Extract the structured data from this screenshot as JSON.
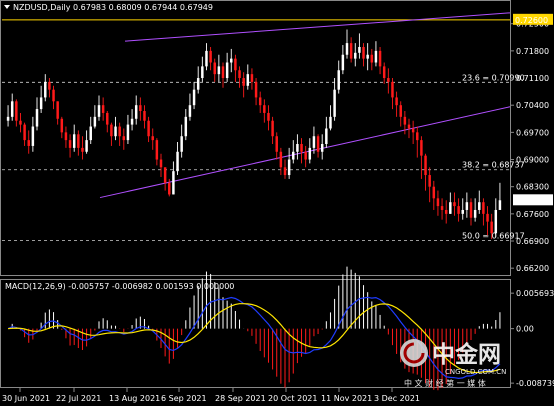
{
  "chart_data": [
    {
      "type": "candlestick",
      "title": "NZDUSD,Daily",
      "ohlc_header": "0.67983 0.68009 0.67944 0.67949",
      "price_ticks": [
        "0.72500",
        "0.71800",
        "0.71100",
        "0.70400",
        "0.69700",
        "0.69000",
        "0.68300",
        "0.67600",
        "0.66900",
        "0.66200"
      ],
      "price_range": [
        0.6605,
        0.7275
      ],
      "current_price": "0.67949",
      "highlight_level": {
        "price": 0.726,
        "label": "0.72600",
        "color": "#ffd700"
      },
      "fib_levels": [
        {
          "label": "23.6 = 0.70990",
          "price": 0.7099
        },
        {
          "label": "38.2 = 0.68737",
          "price": 0.68737
        },
        {
          "label": "50.0 = 0.66917",
          "price": 0.66917
        }
      ],
      "x_labels": [
        "30 Jun 2021",
        "22 Jul 2021",
        "13 Aug 2021",
        "6 Sep 2021",
        "28 Sep 2021",
        "20 Oct 2021",
        "11 Nov 2021",
        "3 Dec 2021"
      ],
      "channel_color": "#b050ff",
      "bull_color": "#ffffff",
      "bear_color": "#ff1a1a",
      "closes": [
        0.701,
        0.705,
        0.7,
        0.699,
        0.695,
        0.6935,
        0.6985,
        0.703,
        0.706,
        0.71,
        0.708,
        0.705,
        0.7005,
        0.697,
        0.695,
        0.693,
        0.6965,
        0.693,
        0.692,
        0.695,
        0.6985,
        0.701,
        0.704,
        0.702,
        0.699,
        0.696,
        0.6985,
        0.696,
        0.695,
        0.699,
        0.7005,
        0.704,
        0.7025,
        0.7,
        0.696,
        0.695,
        0.69,
        0.688,
        0.684,
        0.681,
        0.687,
        0.692,
        0.696,
        0.701,
        0.704,
        0.708,
        0.711,
        0.714,
        0.718,
        0.715,
        0.712,
        0.714,
        0.711,
        0.715,
        0.716,
        0.713,
        0.711,
        0.709,
        0.712,
        0.71,
        0.706,
        0.704,
        0.702,
        0.7,
        0.696,
        0.692,
        0.688,
        0.686,
        0.69,
        0.692,
        0.694,
        0.692,
        0.69,
        0.693,
        0.696,
        0.692,
        0.694,
        0.698,
        0.701,
        0.708,
        0.713,
        0.717,
        0.72,
        0.716,
        0.7175,
        0.719,
        0.716,
        0.717,
        0.715,
        0.718,
        0.714,
        0.711,
        0.71,
        0.706,
        0.704,
        0.701,
        0.699,
        0.698,
        0.697,
        0.695,
        0.691,
        0.686,
        0.683,
        0.68,
        0.678,
        0.677,
        0.676,
        0.679,
        0.678,
        0.676,
        0.677,
        0.679,
        0.675,
        0.677,
        0.679,
        0.676,
        0.674,
        0.671,
        0.677,
        0.6795
      ],
      "highs": [
        0.704,
        0.707,
        0.7055,
        0.702,
        0.6995,
        0.6975,
        0.701,
        0.706,
        0.709,
        0.712,
        0.711,
        0.709,
        0.705,
        0.701,
        0.6985,
        0.6965,
        0.699,
        0.6975,
        0.696,
        0.6975,
        0.701,
        0.704,
        0.7065,
        0.706,
        0.7025,
        0.6995,
        0.701,
        0.6995,
        0.698,
        0.7015,
        0.703,
        0.7065,
        0.706,
        0.704,
        0.701,
        0.698,
        0.6955,
        0.6915,
        0.688,
        0.685,
        0.6895,
        0.6945,
        0.699,
        0.703,
        0.707,
        0.71,
        0.714,
        0.7165,
        0.72,
        0.719,
        0.716,
        0.717,
        0.715,
        0.7175,
        0.7185,
        0.717,
        0.714,
        0.7125,
        0.7145,
        0.7135,
        0.711,
        0.7075,
        0.7055,
        0.704,
        0.701,
        0.697,
        0.693,
        0.69,
        0.693,
        0.695,
        0.6965,
        0.6955,
        0.6935,
        0.6955,
        0.6985,
        0.6965,
        0.6965,
        0.701,
        0.704,
        0.711,
        0.7155,
        0.7195,
        0.7235,
        0.7215,
        0.72,
        0.7225,
        0.72,
        0.72,
        0.7185,
        0.7205,
        0.719,
        0.715,
        0.7135,
        0.711,
        0.7075,
        0.705,
        0.7025,
        0.7005,
        0.7,
        0.6985,
        0.696,
        0.6915,
        0.688,
        0.6845,
        0.682,
        0.68,
        0.6795,
        0.6815,
        0.6815,
        0.68,
        0.68,
        0.6815,
        0.68,
        0.68,
        0.682,
        0.68,
        0.678,
        0.676,
        0.68,
        0.684
      ],
      "lows": [
        0.6985,
        0.7,
        0.6985,
        0.697,
        0.6935,
        0.6915,
        0.692,
        0.6975,
        0.702,
        0.705,
        0.706,
        0.703,
        0.699,
        0.6955,
        0.693,
        0.6905,
        0.692,
        0.691,
        0.69,
        0.6915,
        0.694,
        0.698,
        0.7,
        0.7,
        0.697,
        0.6935,
        0.695,
        0.6935,
        0.6925,
        0.694,
        0.6975,
        0.699,
        0.7,
        0.698,
        0.6945,
        0.6925,
        0.6885,
        0.6855,
        0.682,
        0.6805,
        0.681,
        0.686,
        0.6905,
        0.695,
        0.7,
        0.703,
        0.707,
        0.71,
        0.713,
        0.713,
        0.71,
        0.71,
        0.7085,
        0.71,
        0.7125,
        0.71,
        0.7085,
        0.706,
        0.708,
        0.708,
        0.704,
        0.702,
        0.6995,
        0.6975,
        0.694,
        0.69,
        0.686,
        0.685,
        0.685,
        0.689,
        0.69,
        0.689,
        0.688,
        0.689,
        0.6915,
        0.6905,
        0.69,
        0.693,
        0.6975,
        0.7,
        0.707,
        0.712,
        0.716,
        0.715,
        0.714,
        0.716,
        0.714,
        0.713,
        0.713,
        0.714,
        0.712,
        0.7095,
        0.707,
        0.703,
        0.701,
        0.6985,
        0.6965,
        0.6955,
        0.694,
        0.6905,
        0.685,
        0.682,
        0.679,
        0.677,
        0.6755,
        0.6745,
        0.6735,
        0.676,
        0.6755,
        0.674,
        0.6745,
        0.675,
        0.673,
        0.674,
        0.676,
        0.673,
        0.6705,
        0.6695,
        0.67,
        0.6775
      ]
    },
    {
      "type": "macd",
      "label": "MACD(12,26,9) -0.005757 -0.006982 0.001593 0.000000",
      "y_ticks": [
        "0.005693",
        "0.00",
        "-0.008739"
      ],
      "y_range": [
        -0.0092,
        0.0062
      ],
      "main_color": "#1f3cff",
      "signal_color": "#ffe600",
      "pos_hist_color": "#ffffff",
      "neg_hist_color": "#ff1a1a"
    }
  ],
  "watermark": {
    "logo_text": "中金网",
    "site": "CNGOLD.COM.CN",
    "slogan": "中 文 财 经 第 一 媒 体"
  }
}
